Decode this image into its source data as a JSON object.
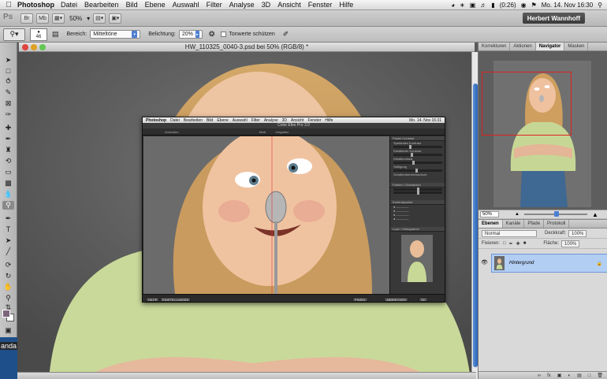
{
  "menubar": {
    "app": "Photoshop",
    "items": [
      "Datei",
      "Bearbeiten",
      "Bild",
      "Ebene",
      "Auswahl",
      "Filter",
      "Analyse",
      "3D",
      "Ansicht",
      "Fenster",
      "Hilfe"
    ],
    "battery": "(0:26)",
    "clock": "Mo. 14. Nov  16:30"
  },
  "appbar": {
    "logo": "Ps",
    "zoom": "50%",
    "user": "Herbert Wannhoff"
  },
  "options": {
    "brush_size": "46",
    "range_label": "Bereich:",
    "range_value": "Mitteltöne",
    "exposure_label": "Belichtung:",
    "exposure_value": "20%",
    "protect_label": "Tonwerte schützen"
  },
  "document": {
    "title": "HW_110325_0040-3.psd bei 50% (RGB/8) *"
  },
  "embed": {
    "menu_app": "Photoshop",
    "menu_items": [
      "Datei",
      "Bearbeiten",
      "Bild",
      "Ebene",
      "Auswahl",
      "Filter",
      "Analyse",
      "3D",
      "Ansicht",
      "Fenster",
      "Hilfe"
    ],
    "clock": "Mo. 14. Nov  16:31",
    "title": "Color Efex Pro 3.0",
    "toolbar": [
      "Ansichten",
      "Modi",
      "Vorgaben"
    ],
    "panel_title": "Pastel Contrast",
    "panel_rows": [
      "Spektrales Kontrast",
      "Detailierter Kontrast",
      "Detailkontrast",
      "Sättigung",
      "Schattenbereichsschutz"
    ],
    "section_color": "Farben / Schwärzen",
    "section_control": "Kontrollpunkte",
    "section_loupe": "Lupe / Histogramm",
    "bottom_buttons": [
      "HILFE",
      "EINSTELLUNGEN",
      "PINSEL",
      "ABBRECHEN",
      "OK"
    ]
  },
  "panels": {
    "top_tabs": [
      "Korrekturen",
      "Aktionen",
      "Navigator",
      "Masken"
    ],
    "nav_zoom": "50%",
    "layer_tabs": [
      "Ebenen",
      "Kanäle",
      "Pfade",
      "Protokoll"
    ],
    "blend_mode": "Normal",
    "opacity_label": "Deckkraft:",
    "opacity_value": "100%",
    "lock_label": "Fixieren:",
    "fill_label": "Fläche:",
    "fill_value": "100%",
    "layer_name": "Hintergrund"
  },
  "leftwin": {
    "text": "anda"
  },
  "colors": {
    "foreground": "#7b657d",
    "background": "#ffffff",
    "accent": "#4a7ed4",
    "selection": "#b3cef3"
  }
}
